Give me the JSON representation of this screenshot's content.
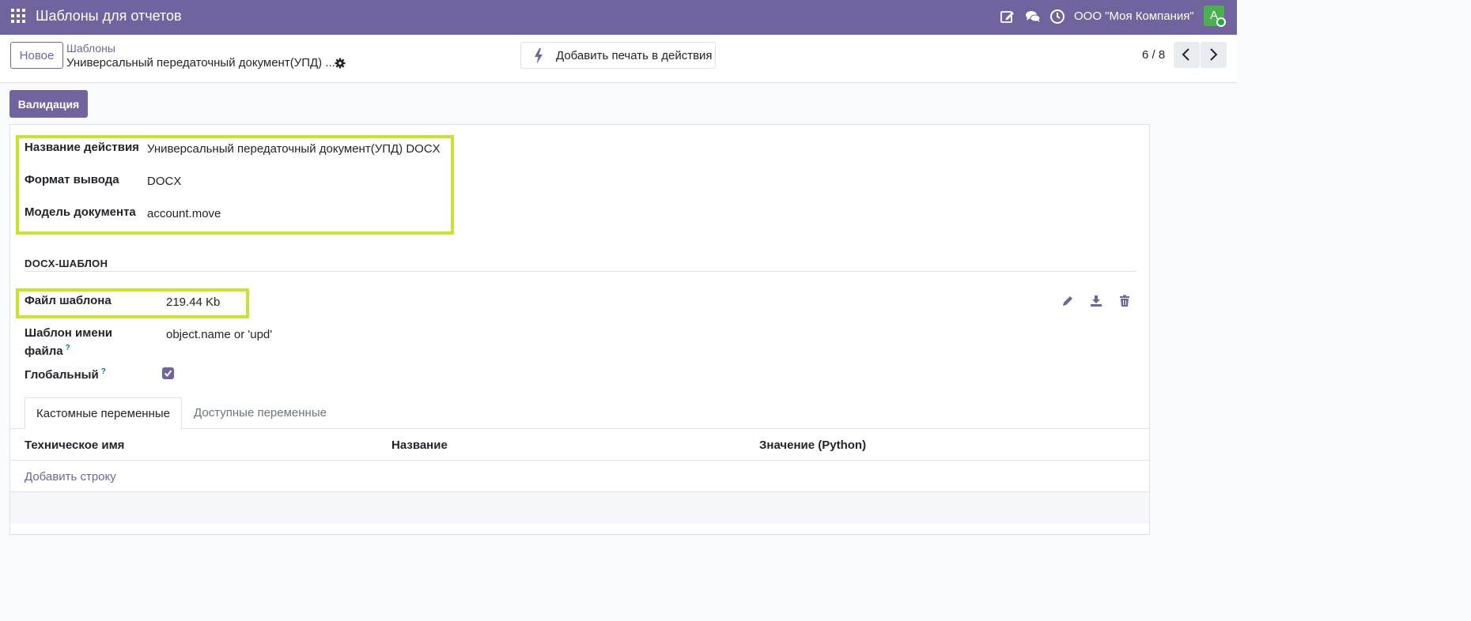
{
  "navbar": {
    "app_title": "Шаблоны для отчетов",
    "company": "ООО \"Моя Компания\"",
    "avatar_letter": "A",
    "color": "#71639e"
  },
  "control_panel": {
    "new_button": "Новое",
    "breadcrumb_parent": "Шаблоны",
    "breadcrumb_current": "Универсальный передаточный документ(УПД) ...",
    "print_button": "Добавить печать в действия",
    "pager": "6 / 8"
  },
  "status": {
    "validate_button": "Валидация"
  },
  "form": {
    "action_name_label": "Название действия",
    "action_name_value": "Универсальный передаточный документ(УПД) DOCX",
    "output_format_label": "Формат вывода",
    "output_format_value": "DOCX",
    "model_label": "Модель документа",
    "model_value": "account.move",
    "section_title": "DOCX-ШАБЛОН",
    "template_file_label": "Файл шаблона",
    "template_file_value": "219.44 Kb",
    "filename_label_line1": "Шаблон имени",
    "filename_label_line2": "файла",
    "filename_value": "object.name or 'upd'",
    "global_label": "Глобальный",
    "global_checked": true,
    "help_mark": "?"
  },
  "tabs": [
    {
      "label": "Кастомные переменные",
      "active": true
    },
    {
      "label": "Доступные переменные",
      "active": false
    }
  ],
  "table": {
    "columns": [
      "Техническое имя",
      "Название",
      "Значение (Python)"
    ],
    "add_row": "Добавить строку"
  },
  "colors": {
    "accent": "#71639e",
    "highlight": "#c5e330"
  }
}
